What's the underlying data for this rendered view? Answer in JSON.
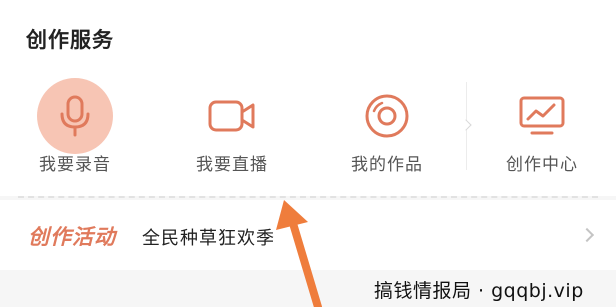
{
  "section": {
    "title": "创作服务"
  },
  "services": [
    {
      "label": "我要录音",
      "icon": "microphone-icon",
      "active": true
    },
    {
      "label": "我要直播",
      "icon": "video-camera-icon",
      "active": false
    },
    {
      "label": "我的作品",
      "icon": "disc-icon",
      "active": false
    },
    {
      "label": "创作中心",
      "icon": "chart-monitor-icon",
      "active": false
    }
  ],
  "activity": {
    "title": "创作活动",
    "text": "全民种草狂欢季"
  },
  "watermark": "搞钱情报局 · gqqbj.vip",
  "colors": {
    "accent": "#e07a5c",
    "active_bg": "#f7c5b4",
    "arrow": "#ef7d3c"
  }
}
